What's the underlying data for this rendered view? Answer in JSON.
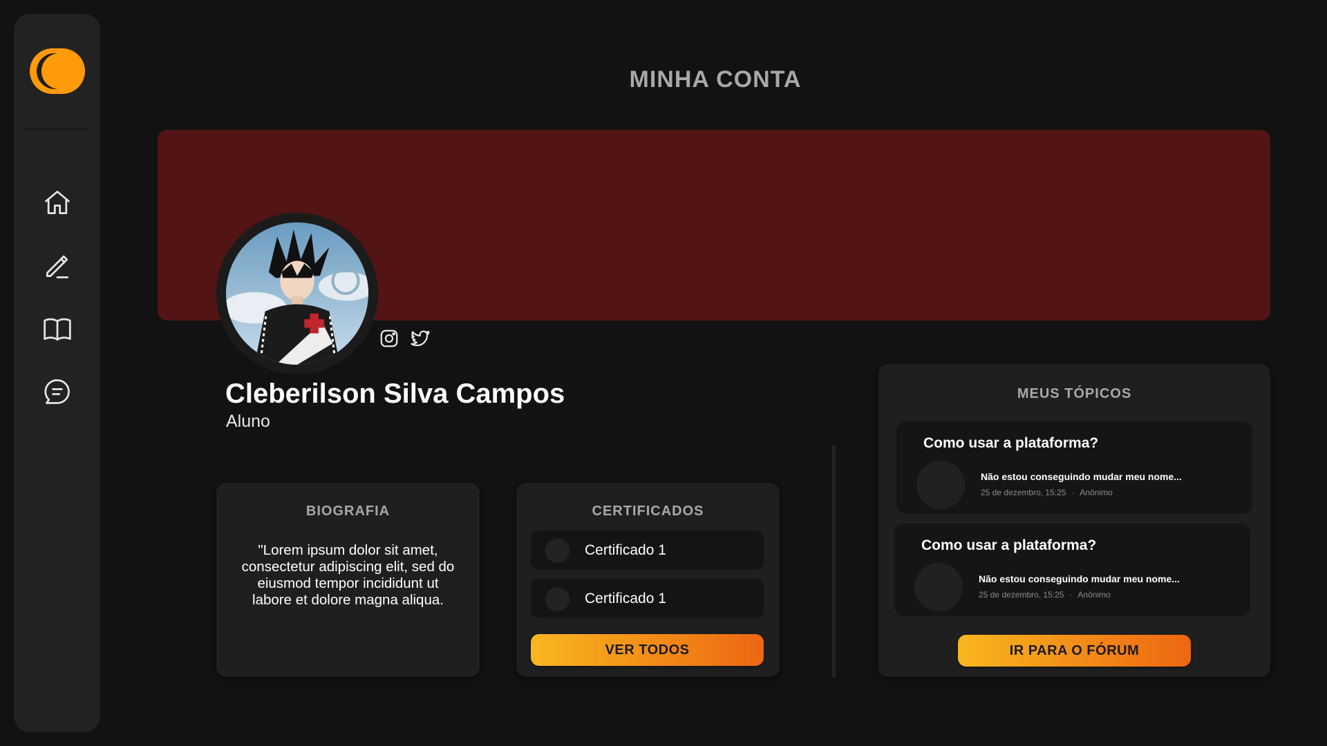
{
  "page": {
    "title": "MINHA CONTA"
  },
  "sidebar": {
    "logo": "logo-icon",
    "items": [
      {
        "id": "home",
        "icon": "home-icon"
      },
      {
        "id": "edit",
        "icon": "pencil-icon"
      },
      {
        "id": "courses",
        "icon": "book-icon"
      },
      {
        "id": "forum",
        "icon": "chat-icon"
      }
    ]
  },
  "profile": {
    "name": "Cleberilson Silva Campos",
    "role": "Aluno",
    "avatar": "user-avatar",
    "social": [
      {
        "id": "instagram",
        "icon": "instagram-icon"
      },
      {
        "id": "twitter",
        "icon": "twitter-icon"
      }
    ]
  },
  "biography": {
    "title": "BIOGRAFIA",
    "text": "\"Lorem ipsum dolor sit amet, consectetur adipiscing elit, sed do eiusmod tempor incididunt ut labore et dolore magna aliqua."
  },
  "certificates": {
    "title": "CERTIFICADOS",
    "items": [
      {
        "label": "Certificado 1"
      },
      {
        "label": "Certificado 1"
      }
    ],
    "button": "VER TODOS"
  },
  "topics": {
    "title": "MEUS TÓPICOS",
    "items": [
      {
        "title": "Como usar a plataforma?",
        "text": "Não estou conseguindo mudar meu nome...",
        "date": "25 de dezembro, 15:25",
        "separator": "·",
        "author": "Anônimo"
      },
      {
        "title": "Como usar a plataforma?",
        "text": "Não estou conseguindo mudar meu nome...",
        "date": "25 de dezembro, 15:25",
        "separator": "·",
        "author": "Anônimo"
      }
    ],
    "button": "IR PARA O FÓRUM"
  },
  "colors": {
    "background": "#121212",
    "panel": "#222222",
    "banner": "#521415",
    "accent_start": "#f8b71f",
    "accent_end": "#ee6611",
    "logo": "#ff9a0a"
  }
}
